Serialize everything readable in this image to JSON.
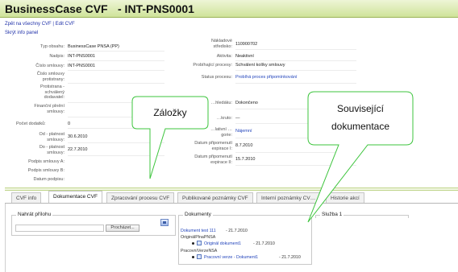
{
  "header": {
    "app_title": "BusinessCase CVF",
    "document_title": "- INT-PNS0001"
  },
  "nav": {
    "back_link": "Zpět na všechny CVF",
    "separator": "|",
    "edit_link": "Edit CVF",
    "hide_info": "Skrýt info panel"
  },
  "left_fields": [
    {
      "label": "Typ obsahu:",
      "value": "BusinessCase PNSA (PP)"
    },
    {
      "label": "Nadpis:",
      "value": "INT-PNS0001"
    },
    {
      "label": "Číslo smlouvy:",
      "value": "INT-PNS0001"
    },
    {
      "label": "Číslo smlouvy protistrany:",
      "value": ""
    },
    {
      "label": "Protistrana - schválený dodavatel:",
      "value": ""
    },
    {
      "label": "Finanční plnění smlouvy:",
      "value": ""
    },
    {
      "label": "Počet dodatků:",
      "value": "0"
    },
    {
      "label": "Od - platnost smlouvy:",
      "value": "30.6.2010"
    },
    {
      "label": "Do - platnost smlouvy:",
      "value": "22.7.2010"
    },
    {
      "label": "Podpis smlouvy A:",
      "value": ""
    },
    {
      "label": "Podpis smlouvy B:",
      "value": ""
    },
    {
      "label": "Datum podpisu:",
      "value": ""
    }
  ],
  "right_fields": [
    {
      "label": "Nákladové středisko:",
      "value": "110900702"
    },
    {
      "label": "Aktivita:",
      "value": "Neaktivní"
    },
    {
      "label": "Probíhající procesy:",
      "value": "Schválení kolíky smlouvy"
    },
    {
      "label": "Status procesu:",
      "value": "Probíhá proces připomínkování"
    },
    {
      "label": "…hledáku:",
      "value": "Dokončeno"
    },
    {
      "label": "…kruto:",
      "value": "—"
    },
    {
      "label": "…lativní …gorie:",
      "value": "Nájemní"
    },
    {
      "label": "Datum připomenutí expirace I:",
      "value": "8.7.2010"
    },
    {
      "label": "Datum připomenutí expirace II:",
      "value": "15.7.2010"
    }
  ],
  "tabs": [
    {
      "label": "CVF info"
    },
    {
      "label": "Dokumentace CVF"
    },
    {
      "label": "Zpracování procesu CVF"
    },
    {
      "label": "Publikované poznámky CVF"
    },
    {
      "label": "Interní poznámky CV…"
    },
    {
      "label": "Historie akcí"
    }
  ],
  "attach": {
    "title": "Nahrát přílohu",
    "browse_label": "Procházet..."
  },
  "documents": {
    "title": "Dokumenty",
    "lines": [
      {
        "text": "Dokument test 111",
        "date": "- 21.7.2010"
      },
      {
        "text": "OriginálPlnaPNSA",
        "date": ""
      },
      {
        "text": "Originál dokument1",
        "date": "- 21.7.2010"
      },
      {
        "text": "PracovníVerzeNSA",
        "date": ""
      },
      {
        "text": "Pracovní verze - Dokument1",
        "date": "- 21.7.2010"
      }
    ]
  },
  "service": {
    "title": "Služba 1"
  },
  "callouts": {
    "bookmarks": "Záložky",
    "related_line1": "Související",
    "related_line2": "dokumentace"
  },
  "colors": {
    "header_green": "#cfe39a",
    "link_blue": "#2244bb",
    "callout_line": "#3cc43c"
  }
}
